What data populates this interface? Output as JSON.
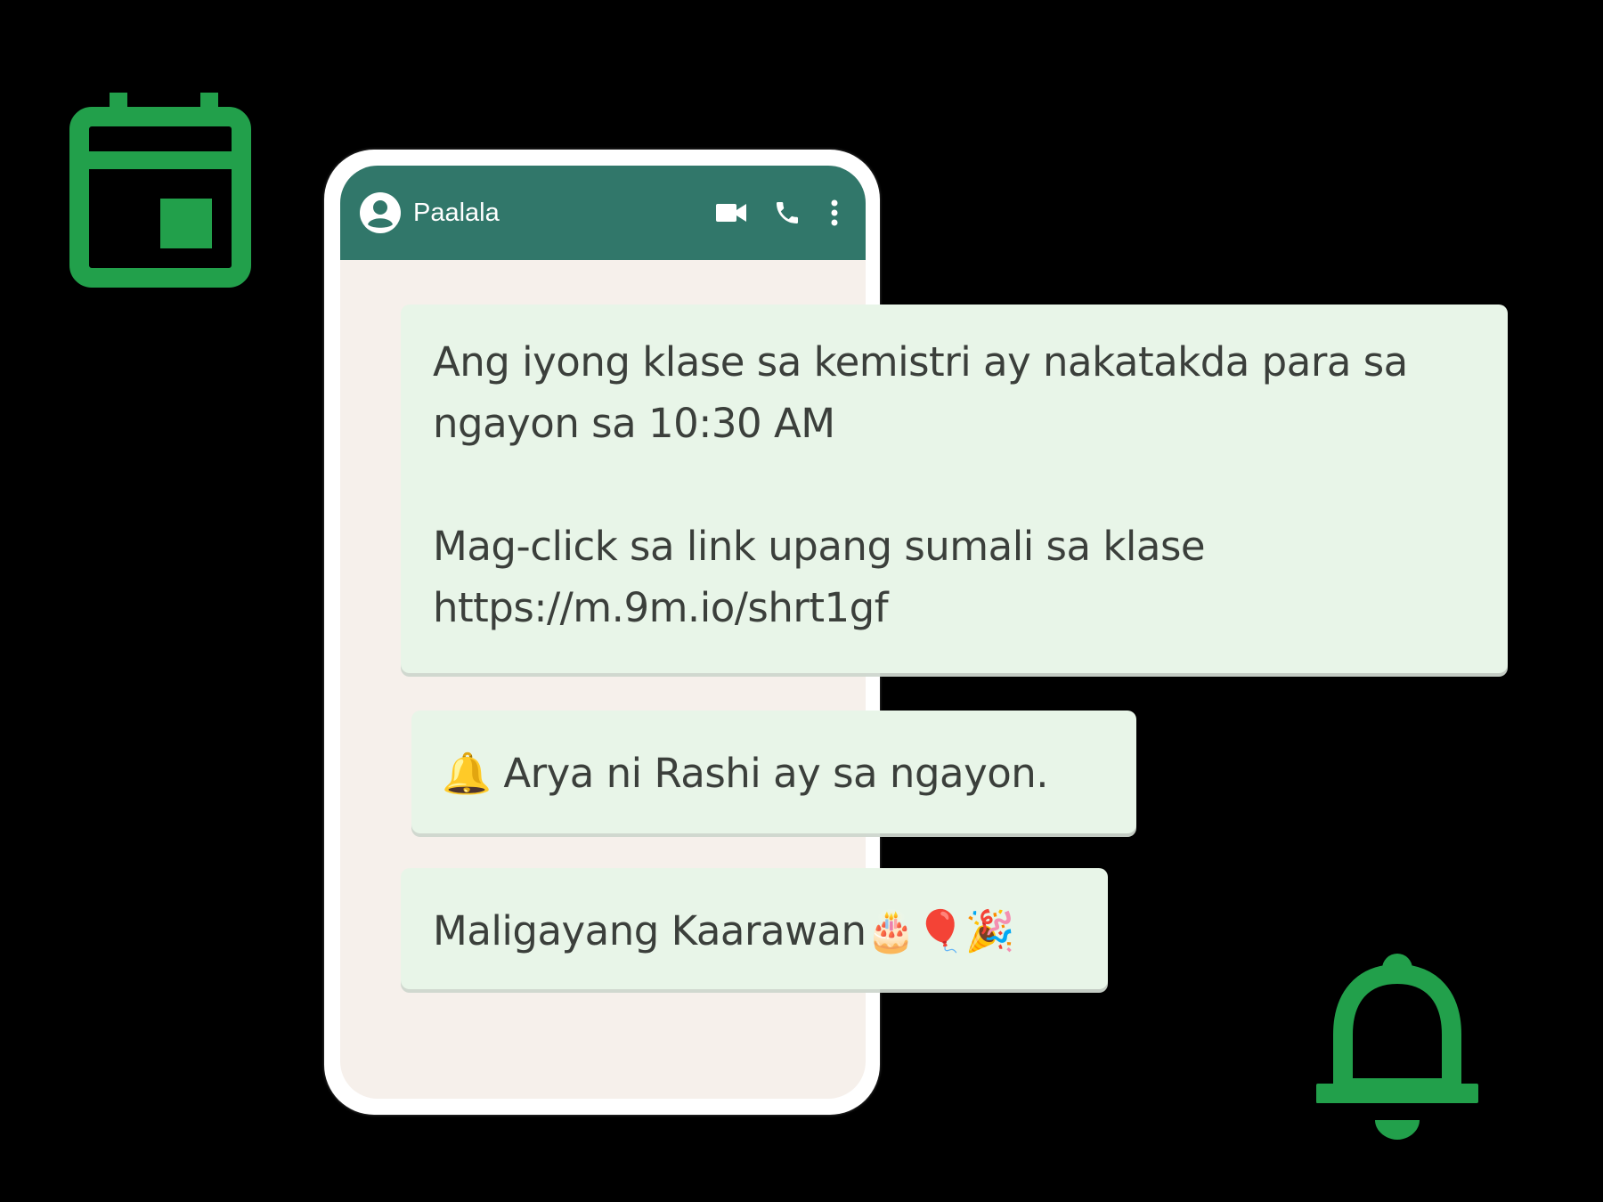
{
  "chat": {
    "contact_name": "Paalala",
    "icons": {
      "avatar": "user-avatar-icon",
      "video": "video-camera-icon",
      "call": "phone-icon",
      "menu": "more-vertical-icon"
    },
    "header_color": "#31776a",
    "background_color": "#f6f0eb",
    "bubble_color": "#e8f5e8"
  },
  "messages": [
    {
      "paragraph_1": "Ang iyong klase sa kemistri ay nakatakda para sa ngayon sa 10:30 AM",
      "paragraph_2": "Mag-click sa link upang sumali sa klase https://m.9m.io/shrt1gf"
    },
    {
      "emoji": "🔔",
      "text": "Arya ni Rashi ay sa ngayon."
    },
    {
      "text": "Maligayang Kaarawan",
      "emoji": "🎂🎈🎉"
    }
  ],
  "decorations": {
    "accent_color": "#22a04b",
    "calendar": "calendar-icon",
    "bell": "bell-icon"
  }
}
